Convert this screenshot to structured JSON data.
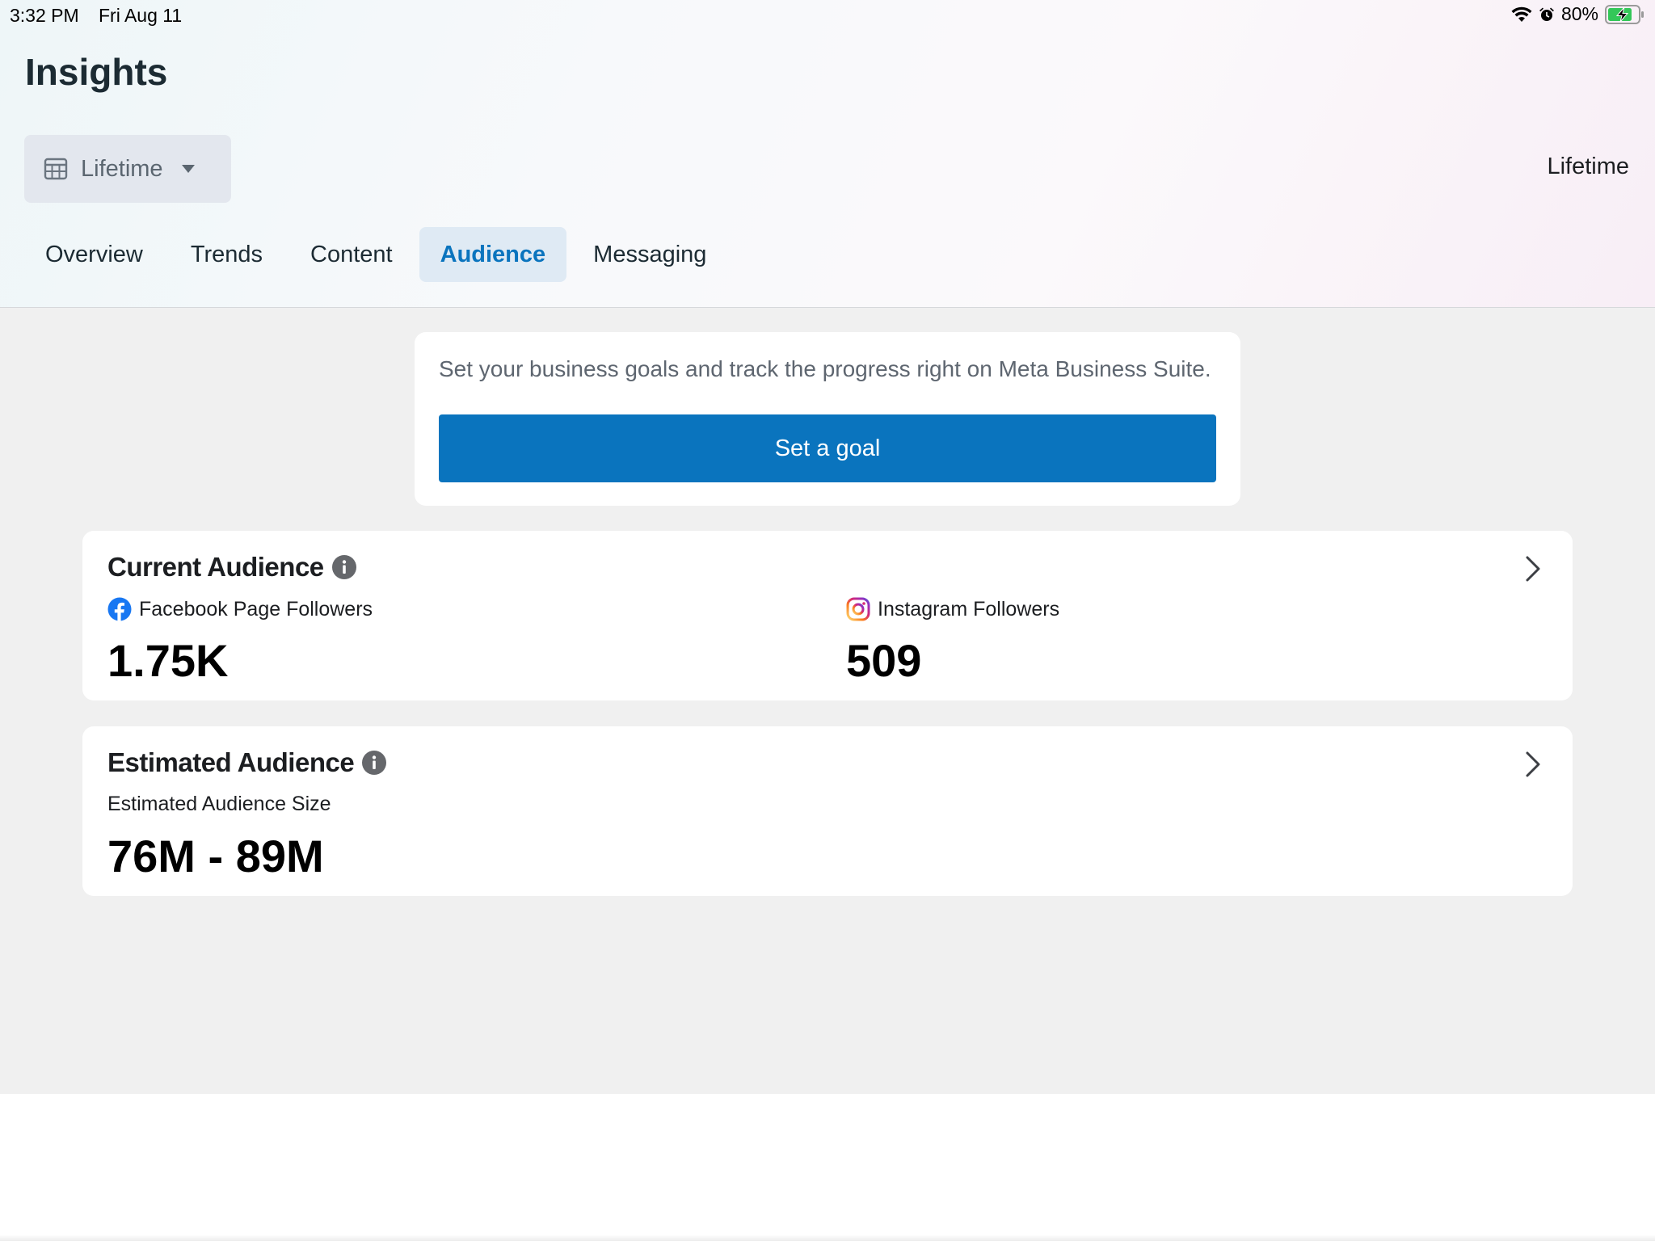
{
  "status_bar": {
    "time": "3:32 PM",
    "date": "Fri Aug 11",
    "battery": "80%",
    "icons": [
      "wifi-icon",
      "alarm-icon",
      "battery-charging-icon"
    ]
  },
  "header": {
    "title": "Insights",
    "date_range": {
      "selected": "Lifetime",
      "icon": "calendar-icon",
      "summary": "Lifetime"
    },
    "tabs": [
      {
        "label": "Overview",
        "active": false
      },
      {
        "label": "Trends",
        "active": false
      },
      {
        "label": "Content",
        "active": false
      },
      {
        "label": "Audience",
        "active": true
      },
      {
        "label": "Messaging",
        "active": false
      }
    ]
  },
  "goal_card": {
    "text": "Set your business goals and track the progress right on Meta Business Suite.",
    "button_label": "Set a goal"
  },
  "current_audience": {
    "title": "Current Audience",
    "facebook": {
      "label": "Facebook Page Followers",
      "value": "1.75K",
      "icon": "facebook-icon"
    },
    "instagram": {
      "label": "Instagram Followers",
      "value": "509",
      "icon": "instagram-icon"
    }
  },
  "estimated_audience": {
    "title": "Estimated Audience",
    "label": "Estimated Audience Size",
    "value": "76M - 89M"
  },
  "colors": {
    "accent": "#0a74be",
    "active_tab_bg": "#dfeaf4",
    "content_bg": "#f0f0f0"
  }
}
